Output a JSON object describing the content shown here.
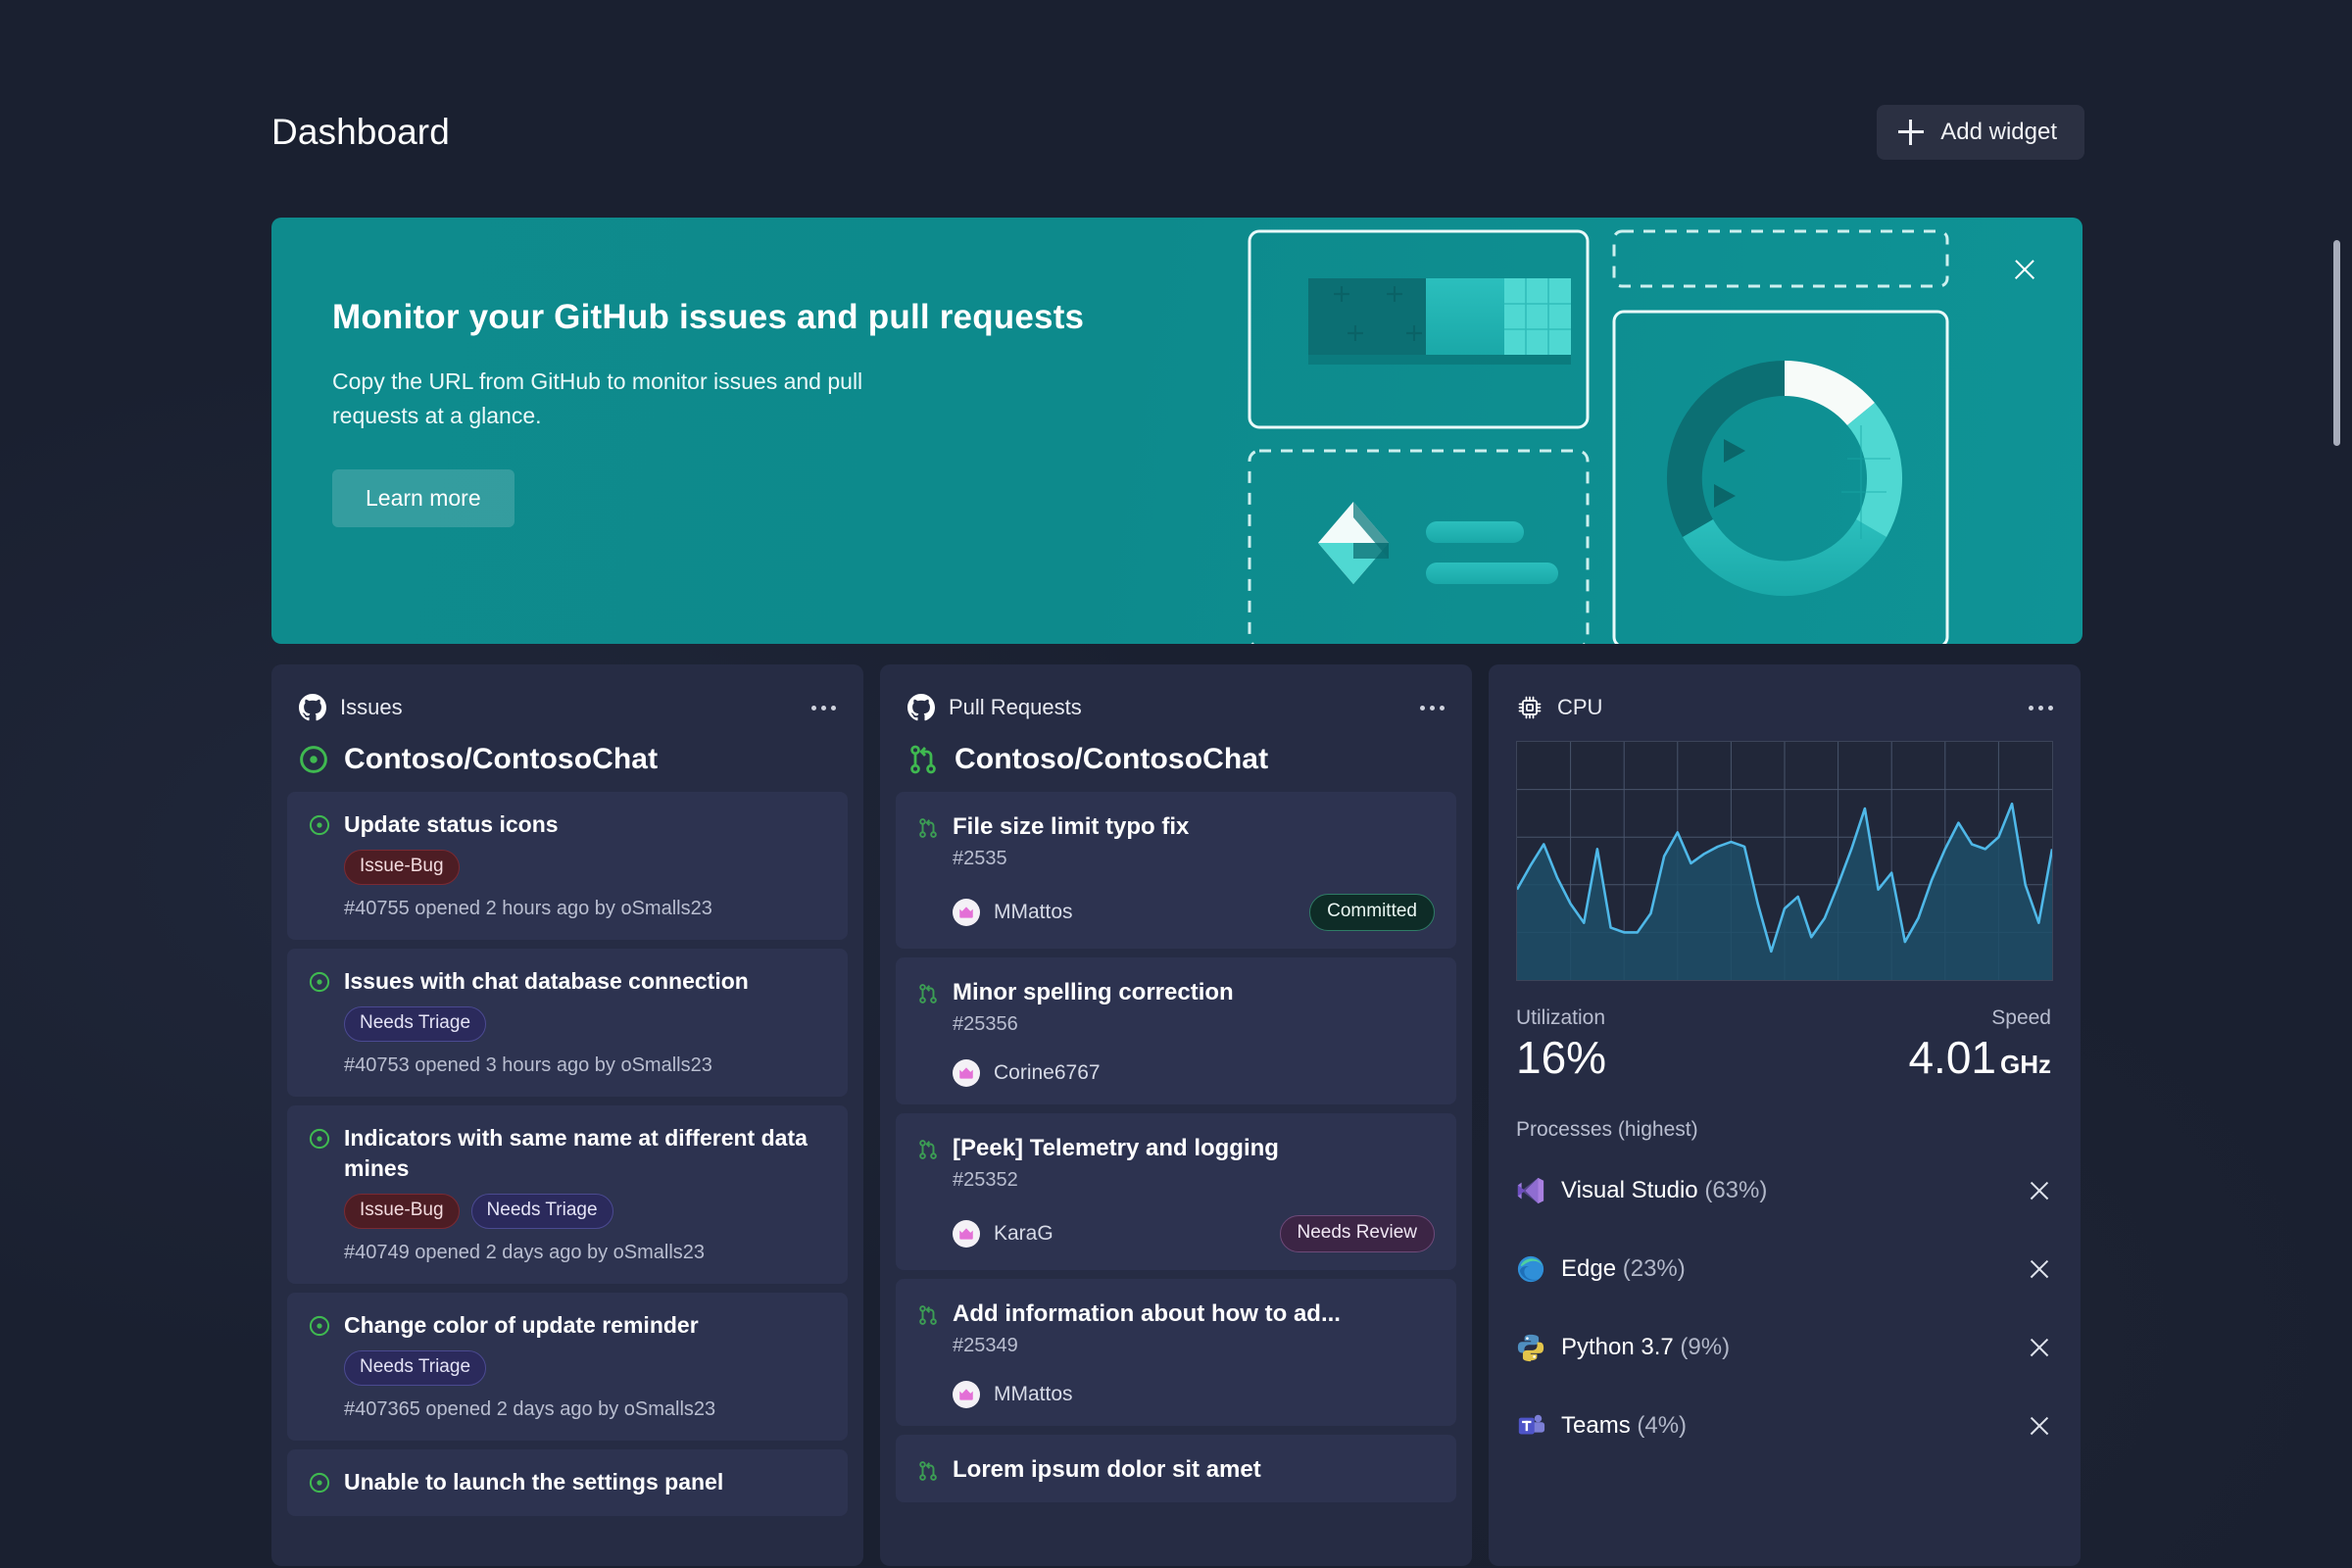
{
  "header": {
    "title": "Dashboard",
    "add_widget_label": "Add widget",
    "add_icon": "plus-icon"
  },
  "banner": {
    "title": "Monitor your GitHub issues and pull requests",
    "subtitle": "Copy the URL from GitHub to monitor issues and pull requests at a glance.",
    "button_label": "Learn more",
    "close_icon": "close-icon",
    "accent_color": "#0e8b8d"
  },
  "issues_card": {
    "header_icon": "github-icon",
    "header_title": "Issues",
    "more_icon": "more-options-icon",
    "repo_icon": "issue-opened-icon",
    "repo_name": "Contoso/ContosoChat",
    "items": [
      {
        "title": "Update status icons",
        "tags": [
          "Issue-Bug"
        ],
        "meta": "#40755 opened 2 hours ago by oSmalls23"
      },
      {
        "title": "Issues with chat database connection",
        "tags": [
          "Needs Triage"
        ],
        "meta": "#40753 opened 3 hours ago by oSmalls23"
      },
      {
        "title": "Indicators with same name at different data mines",
        "tags": [
          "Issue-Bug",
          "Needs Triage"
        ],
        "meta": "#40749 opened 2 days ago by oSmalls23"
      },
      {
        "title": "Change color of update reminder",
        "tags": [
          "Needs Triage"
        ],
        "meta": "#407365 opened 2 days ago by oSmalls23"
      },
      {
        "title": "Unable to launch the settings panel",
        "tags": [],
        "meta": ""
      }
    ]
  },
  "pull_requests_card": {
    "header_icon": "github-icon",
    "header_title": "Pull Requests",
    "more_icon": "more-options-icon",
    "repo_icon": "git-pull-request-icon",
    "repo_name": "Contoso/ContosoChat",
    "items": [
      {
        "title": "File size limit typo fix",
        "number": "#2535",
        "user": "MMattos",
        "badge": "Committed",
        "badge_kind": "committed"
      },
      {
        "title": "Minor spelling correction",
        "number": "#25356",
        "user": "Corine6767",
        "badge": "",
        "badge_kind": ""
      },
      {
        "title": "[Peek] Telemetry and logging",
        "number": "#25352",
        "user": "KaraG",
        "badge": "Needs Review",
        "badge_kind": "review"
      },
      {
        "title": "Add information about how to ad...",
        "number": "#25349",
        "user": "MMattos",
        "badge": "",
        "badge_kind": ""
      },
      {
        "title": "Lorem ipsum dolor sit amet",
        "number": "",
        "user": "",
        "badge": "",
        "badge_kind": ""
      }
    ]
  },
  "cpu_card": {
    "header_icon": "cpu-chip-icon",
    "header_title": "CPU",
    "more_icon": "more-options-icon",
    "utilization_label": "Utilization",
    "utilization_value": "16%",
    "speed_label": "Speed",
    "speed_value": "4.01",
    "speed_unit": "GHz",
    "processes_label": "Processes (highest)",
    "processes": [
      {
        "icon": "visual-studio-icon",
        "name": "Visual Studio",
        "percent": "(63%)"
      },
      {
        "icon": "edge-icon",
        "name": "Edge",
        "percent": "(23%)"
      },
      {
        "icon": "python-icon",
        "name": "Python 3.7",
        "percent": "(9%)"
      },
      {
        "icon": "teams-icon",
        "name": "Teams",
        "percent": "(4%)"
      }
    ],
    "chart_data": {
      "type": "line",
      "title": "CPU utilization over time",
      "xlabel": "",
      "ylabel": "",
      "ylim": [
        0,
        100
      ],
      "grid": true,
      "legend": "none",
      "line_color": "#4fb8e8",
      "fill_color": "#1d4f68",
      "x": [
        0,
        1,
        2,
        3,
        4,
        5,
        6,
        7,
        8,
        9,
        10,
        11,
        12,
        13,
        14,
        15,
        16,
        17,
        18,
        19,
        20,
        21,
        22,
        23,
        24,
        25,
        26,
        27,
        28,
        29,
        30,
        31,
        32,
        33,
        34,
        35,
        36,
        37,
        38,
        39,
        40
      ],
      "values": [
        38,
        48,
        57,
        43,
        32,
        24,
        55,
        22,
        20,
        20,
        28,
        52,
        62,
        49,
        53,
        56,
        58,
        56,
        32,
        12,
        30,
        35,
        18,
        26,
        40,
        55,
        72,
        38,
        45,
        16,
        26,
        42,
        55,
        66,
        57,
        55,
        60,
        74,
        40,
        24,
        55
      ]
    }
  }
}
